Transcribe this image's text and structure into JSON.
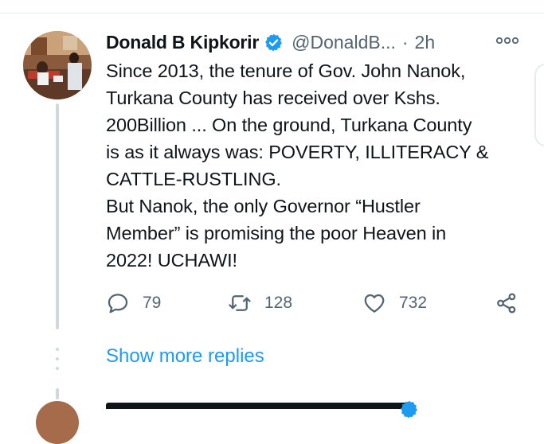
{
  "tweet": {
    "author_name": "Donald B Kipkorir",
    "handle": "@DonaldB...",
    "separator": "·",
    "time": "2h",
    "verified": true,
    "text": "Since 2013, the tenure of Gov. John Nanok,\nTurkana County has received over Kshs.\n200Billion ... On the ground, Turkana County\nis as it always was: POVERTY, ILLITERACY &\nCATTLE-RUSTLING.\nBut Nanok, the only Governor “Hustler\nMember” is promising the poor Heaven in\n2022! UCHAWI!",
    "replies": "79",
    "retweets": "128",
    "likes": "732"
  },
  "thread": {
    "show_more_label": "Show more replies"
  },
  "icons": {
    "reply": "reply-icon",
    "retweet": "retweet-icon",
    "like": "heart-icon",
    "share": "share-icon",
    "more": "more-options-icon",
    "verified": "verified-badge-icon"
  },
  "colors": {
    "accent": "#1d9bf0",
    "muted": "#536471",
    "text": "#0f1419"
  }
}
